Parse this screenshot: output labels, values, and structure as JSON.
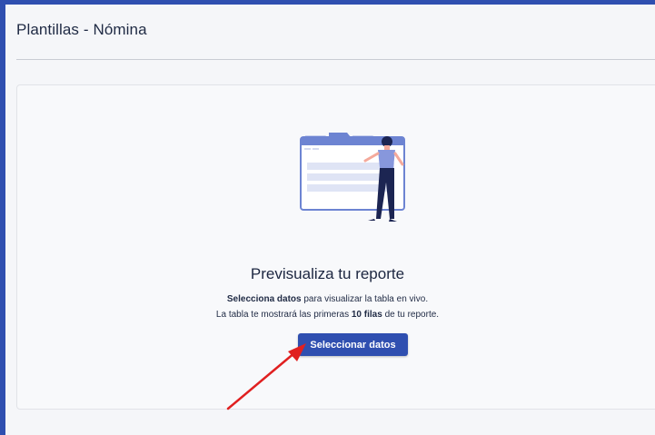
{
  "header": {
    "title": "Plantillas - Nómina"
  },
  "empty_state": {
    "illustration": "report-preview-illustration",
    "heading": "Previsualiza tu reporte",
    "line1_bold": "Selecciona datos",
    "line1_rest": " para visualizar la tabla en vivo.",
    "line2_prefix": "La tabla te mostrará las primeras ",
    "line2_bold": "10 filas",
    "line2_suffix": " de tu reporte.",
    "button_label": "Seleccionar datos"
  },
  "annotation": {
    "icon": "red-arrow-icon",
    "color": "#e02020"
  },
  "colors": {
    "accent": "#2f4fb0"
  }
}
